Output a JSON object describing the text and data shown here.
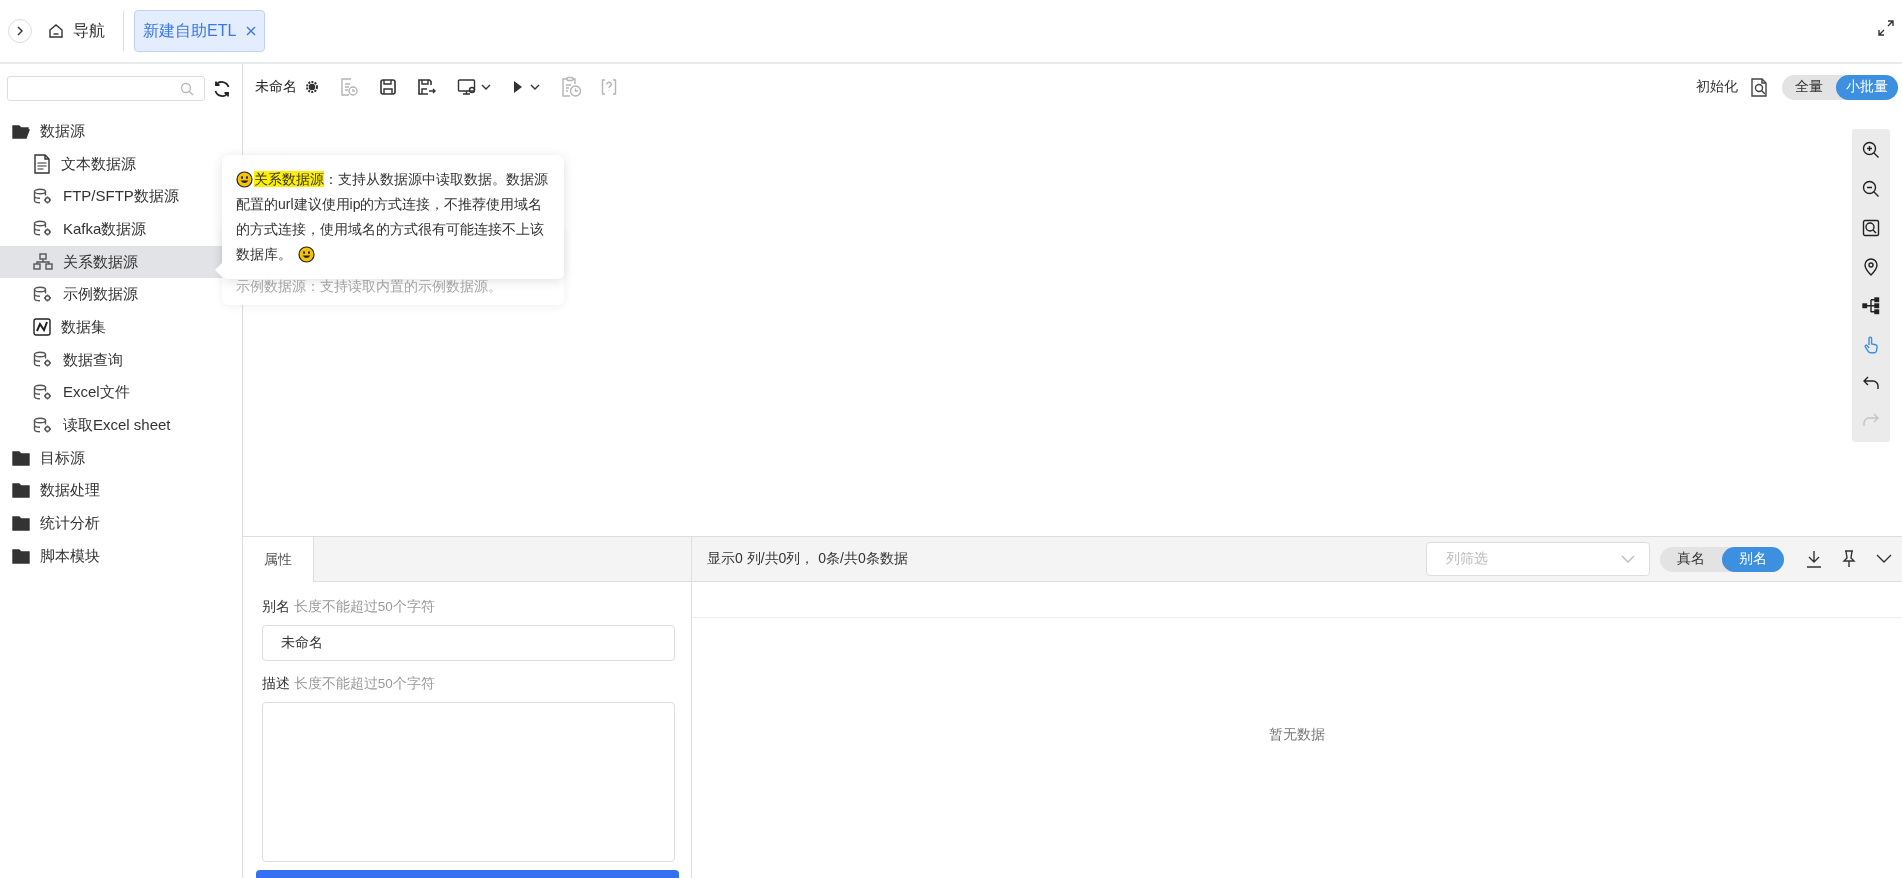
{
  "tab_bar": {
    "nav_label": "导航",
    "tabs": [
      {
        "label": "新建自助ETL",
        "selected": true
      }
    ]
  },
  "sidebar": {
    "tree": [
      {
        "label": "数据源",
        "expanded": true,
        "children": [
          {
            "label": "文本数据源",
            "kind": "text-file",
            "selected": false
          },
          {
            "label": "FTP/SFTP数据源",
            "kind": "database",
            "selected": false
          },
          {
            "label": "Kafka数据源",
            "kind": "database",
            "selected": false
          },
          {
            "label": "关系数据源",
            "kind": "relation",
            "selected": true
          },
          {
            "label": "示例数据源",
            "kind": "database",
            "selected": false
          },
          {
            "label": "数据集",
            "kind": "dataset",
            "selected": false
          },
          {
            "label": "数据查询",
            "kind": "database",
            "selected": false
          },
          {
            "label": "Excel文件",
            "kind": "database",
            "selected": false
          },
          {
            "label": "读取Excel sheet",
            "kind": "database",
            "selected": false
          }
        ]
      },
      {
        "label": "目标源",
        "expanded": false
      },
      {
        "label": "数据处理",
        "expanded": false
      },
      {
        "label": "统计分析",
        "expanded": false
      },
      {
        "label": "脚本模块",
        "expanded": false
      }
    ]
  },
  "toolbar": {
    "title": "未命名",
    "buttons": [
      {
        "kind": "settings",
        "disabled": false
      },
      {
        "kind": "report",
        "disabled": true
      },
      {
        "kind": "save",
        "disabled": false
      },
      {
        "kind": "save-as",
        "disabled": false
      },
      {
        "kind": "monitor",
        "disabled": false
      },
      {
        "kind": "run",
        "disabled": false
      },
      {
        "kind": "schedule",
        "disabled": true
      },
      {
        "kind": "help",
        "disabled": true
      }
    ],
    "init_label": "初始化",
    "modes": [
      {
        "label": "全量",
        "selected": false
      },
      {
        "label": "小批量",
        "selected": true
      }
    ]
  },
  "canvas_tools": [
    {
      "kind": "zoom-in",
      "selected": false,
      "disabled": false
    },
    {
      "kind": "zoom-out",
      "selected": false,
      "disabled": false
    },
    {
      "kind": "fit",
      "selected": false,
      "disabled": false
    },
    {
      "kind": "locate",
      "selected": false,
      "disabled": false
    },
    {
      "kind": "tree",
      "selected": false,
      "disabled": false
    },
    {
      "kind": "hand",
      "selected": true,
      "disabled": false
    },
    {
      "kind": "undo",
      "selected": false,
      "disabled": false
    },
    {
      "kind": "redo",
      "selected": false,
      "disabled": true
    }
  ],
  "tooltip": {
    "term": "关系数据源",
    "text": "：支持从数据源中读取数据。数据源配置的url建议使用ip的方式连接，不推荐使用域名的方式连接，使用域名的方式很有可能连接不上该数据库。",
    "faded_text": "示例数据源：支持读取内置的示例数据源。"
  },
  "properties": {
    "tabs": [
      {
        "label": "属性",
        "selected": true
      }
    ],
    "fields": [
      {
        "kind": "input",
        "label": "别名",
        "hint": "长度不能超过50个字符",
        "value": "未命名"
      },
      {
        "kind": "textarea",
        "label": "描述",
        "hint": "长度不能超过50个字符"
      }
    ]
  },
  "preview": {
    "summary": "显示0 列/共0列， 0条/共0条数据",
    "filter": {
      "placeholder": "列筛选"
    },
    "name_modes": [
      {
        "label": "真名",
        "selected": false
      },
      {
        "label": "别名",
        "selected": true
      }
    ],
    "empty_text": "暂无数据"
  }
}
